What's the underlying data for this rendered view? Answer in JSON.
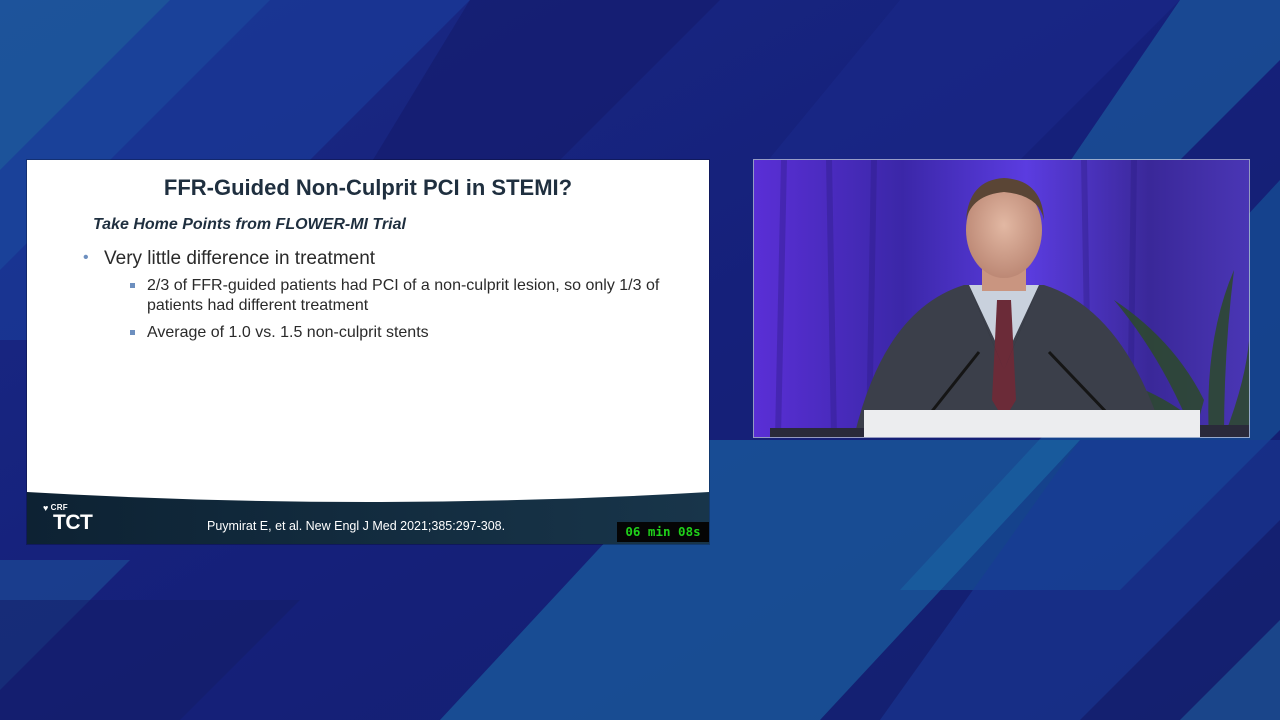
{
  "slide": {
    "title": "FFR-Guided Non-Culprit PCI in STEMI?",
    "subtitle": "Take Home Points from FLOWER-MI Trial",
    "bullets": [
      {
        "text": "Very little difference in treatment",
        "sub": [
          "2/3 of FFR-guided patients had PCI of a non-culprit lesion, so only 1/3 of patients had different treatment",
          "Average of 1.0 vs. 1.5 non-culprit stents"
        ]
      }
    ],
    "citation": "Puymirat E, et al. New Engl J Med 2021;385:297-308.",
    "logo": {
      "crf": "CRF",
      "tct": "TCT",
      "icon": "heart-icon"
    }
  },
  "timer": {
    "text": "06 min 08s",
    "text_color": "#1fd11a"
  },
  "video": {
    "icon": "speaker-video-feed"
  },
  "colors": {
    "background": "#17206a",
    "slide_title": "#1f2f3f",
    "footer_dark": "#0d2233",
    "bullet_accent": "#6d8fbf",
    "stage_purple": "#4a2fc0"
  }
}
